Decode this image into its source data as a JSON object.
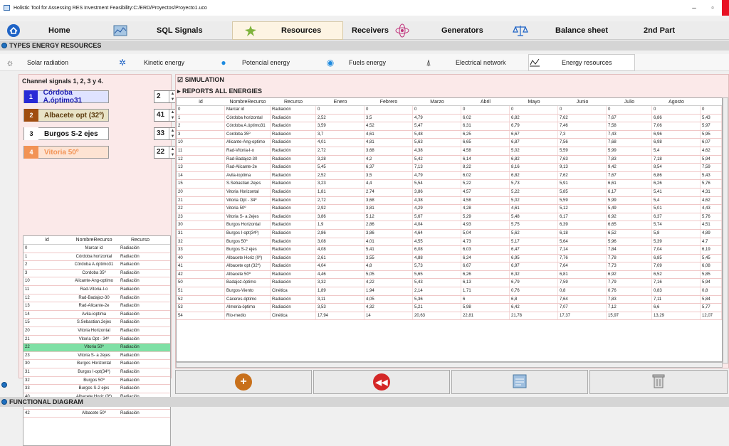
{
  "window": {
    "title": "Holistic Tool for Assessing RES Investment Feasibility:C:/ERD/Proyectos/Proyecto1.uco",
    "minimize": "–",
    "maximize": "▫",
    "close": "✕"
  },
  "nav": [
    {
      "label": "Home",
      "icon": "home-icon"
    },
    {
      "label": "SQL Signals",
      "icon": "signals-icon"
    },
    {
      "label": "Resources",
      "icon": "resources-icon"
    },
    {
      "label": "Receivers",
      "icon": "receivers-icon"
    },
    {
      "label": "Generators",
      "icon": "generators-icon"
    },
    {
      "label": "Balance sheet",
      "icon": "balance-icon"
    },
    {
      "label": "2nd Part",
      "icon": ""
    }
  ],
  "section_types": "TYPES ENERGY RESOURCES",
  "energy_tabs": [
    {
      "label": "Solar radiation",
      "icon": "sun-icon"
    },
    {
      "label": "Kinetic energy",
      "icon": "wind-icon"
    },
    {
      "label": "Potencial energy",
      "icon": "drop-icon"
    },
    {
      "label": "Fuels energy",
      "icon": "fuel-icon"
    },
    {
      "label": "Electrical network",
      "icon": "tower-icon"
    },
    {
      "label": "Energy resources",
      "icon": "chart-icon"
    }
  ],
  "left": {
    "title": "Channel signals 1,  2,  3 y 4.",
    "signals": [
      {
        "num": "1",
        "name": "Córdoba A.óptimo31",
        "spin": "2",
        "color": "#2a2ad6",
        "text": "#1d1db0",
        "bg": "#dfe3ff"
      },
      {
        "num": "2",
        "name": "Albacete opt (32º)",
        "spin": "41",
        "color": "#a04d10",
        "text": "#5b3a0c",
        "bg": "#e8e3c6"
      },
      {
        "num": "3",
        "name": "Burgos S-2 ejes",
        "spin": "33",
        "color": "#ffffff",
        "text": "#111",
        "bg": "#ffffff"
      },
      {
        "num": "4",
        "name": "Vitoria 50º",
        "spin": "22",
        "color": "#f29355",
        "text": "#f29355",
        "bg": "#fde3d3"
      }
    ],
    "table_headers": [
      "id",
      "NombreRecurso",
      "Recurso"
    ],
    "rows": [
      [
        "0",
        "Marcar id",
        "Radiación"
      ],
      [
        "1",
        "Córdoba horizontal",
        "Radiación"
      ],
      [
        "2",
        "Córdoba A.óptimo31",
        "Radiación"
      ],
      [
        "3",
        "Cordoba 35º",
        "Radiación"
      ],
      [
        "10",
        "Alicante-Ang-optimo",
        "Radiación"
      ],
      [
        "11",
        "Rad-Vitoria-I-o",
        "Radiación"
      ],
      [
        "12",
        "Rad-Badajoz-30",
        "Radiación"
      ],
      [
        "13",
        "Rad-Alicante-2e",
        "Radiación"
      ],
      [
        "14",
        "Avila-ioptima",
        "Radiación"
      ],
      [
        "15",
        "S.Sebastian.2ejes",
        "Radiación"
      ],
      [
        "20",
        "Vitoria Horizontal",
        "Radiación"
      ],
      [
        "21",
        "Vitoria Opt - 34º",
        "Radiación"
      ],
      [
        "22",
        "Vitoria 50º",
        "Radiación"
      ],
      [
        "23",
        "Vitoria S- a 2ejes",
        "Radiación"
      ],
      [
        "30",
        "Burgos Horizontal",
        "Radiación"
      ],
      [
        "31",
        "Burgos I-opt(34º)",
        "Radiación"
      ],
      [
        "32",
        "Burgos 50º",
        "Radiación"
      ],
      [
        "33",
        "Burgos S-2 ejes",
        "Radiación"
      ],
      [
        "40",
        "Albacete Horiz (0º)",
        "Radiación"
      ],
      [
        "41",
        "Albacete opt (32º)",
        "Radiación"
      ],
      [
        "42",
        "Albacete 50º",
        "Radiación"
      ]
    ],
    "selected_row": 12
  },
  "right": {
    "simulation": "SIMULATION",
    "reports": "REPORTS ALL ENERGIES",
    "headers": [
      "id",
      "NombreRecurso",
      "Recurso",
      "Enero",
      "Febrero",
      "Marzo",
      "Abril",
      "Mayo",
      "Junio",
      "Julio",
      "Agosto",
      ""
    ],
    "rows": [
      [
        "0",
        "Marcar id",
        "Radiación",
        "0",
        "0",
        "0",
        "0",
        "0",
        "0",
        "0",
        "0",
        "0"
      ],
      [
        "1",
        "Córdoba horizontal",
        "Radiación",
        "2,52",
        "3,5",
        "4,79",
        "6,02",
        "6,82",
        "7,62",
        "7,67",
        "6,86",
        "5,43"
      ],
      [
        "2",
        "Córdoba A.óptimo31",
        "Radiación",
        "3,59",
        "4,52",
        "5,47",
        "6,31",
        "6,79",
        "7,46",
        "7,58",
        "7,06",
        "5,97"
      ],
      [
        "3",
        "Cordoba 35º",
        "Radiación",
        "3,7",
        "4,61",
        "5,48",
        "6,25",
        "6,67",
        "7,3",
        "7,43",
        "6,96",
        "5,95"
      ],
      [
        "10",
        "Alicante-Ang-optimo",
        "Radiación",
        "4,01",
        "4,81",
        "5,63",
        "6,65",
        "6,87",
        "7,56",
        "7,68",
        "6,98",
        "6,07"
      ],
      [
        "11",
        "Rad-Vitoria-I-o",
        "Radiación",
        "2,72",
        "3,68",
        "4,38",
        "4,58",
        "5,02",
        "5,59",
        "5,99",
        "5,4",
        "4,62"
      ],
      [
        "12",
        "Rad-Badajoz-30",
        "Radiación",
        "3,28",
        "4,2",
        "5,42",
        "6,14",
        "6,82",
        "7,63",
        "7,83",
        "7,18",
        "5,94"
      ],
      [
        "13",
        "Rad-Alicante-2e",
        "Radiación",
        "5,45",
        "6,37",
        "7,13",
        "8,22",
        "8,16",
        "9,13",
        "9,42",
        "8,54",
        "7,59"
      ],
      [
        "14",
        "Avila-ioptima",
        "Radiación",
        "2,52",
        "3,5",
        "4,79",
        "6,02",
        "6,82",
        "7,62",
        "7,67",
        "6,86",
        "5,43"
      ],
      [
        "15",
        "S.Sebastian.2ejes",
        "Radiación",
        "3,23",
        "4,4",
        "5,54",
        "5,22",
        "5,73",
        "5,91",
        "6,61",
        "6,26",
        "5,76"
      ],
      [
        "20",
        "Vitoria Horizontal",
        "Radiación",
        "1,81",
        "2,74",
        "3,86",
        "4,57",
        "5,22",
        "5,85",
        "6,17",
        "5,41",
        "4,31"
      ],
      [
        "21",
        "Vitoria Opt - 34º",
        "Radiación",
        "2,72",
        "3,68",
        "4,38",
        "4,58",
        "5,02",
        "5,59",
        "5,99",
        "5,4",
        "4,62"
      ],
      [
        "22",
        "Vitoria 50º",
        "Radiación",
        "2,92",
        "3,81",
        "4,29",
        "4,28",
        "4,61",
        "5,12",
        "5,49",
        "5,01",
        "4,43"
      ],
      [
        "23",
        "Vitoria S- a 2ejes",
        "Radiación",
        "3,86",
        "5,12",
        "5,67",
        "5,29",
        "5,48",
        "6,17",
        "6,92",
        "6,37",
        "5,76"
      ],
      [
        "30",
        "Burgos Horizontal",
        "Radiación",
        "1,9",
        "2,86",
        "4,04",
        "4,93",
        "5,75",
        "6,39",
        "6,65",
        "5,74",
        "4,51"
      ],
      [
        "31",
        "Burgos I-opt(34º)",
        "Radiación",
        "2,86",
        "3,86",
        "4,64",
        "5,04",
        "5,62",
        "6,18",
        "6,52",
        "5,8",
        "4,89"
      ],
      [
        "32",
        "Burgos 50º",
        "Radiación",
        "3,08",
        "4,01",
        "4,55",
        "4,73",
        "5,17",
        "5,64",
        "5,96",
        "5,39",
        "4,7"
      ],
      [
        "33",
        "Burgos S-2 ejes",
        "Radiación",
        "4,08",
        "5,41",
        "6,08",
        "6,03",
        "6,47",
        "7,14",
        "7,84",
        "7,04",
        "6,19"
      ],
      [
        "40",
        "Albacete Horiz (0º)",
        "Radiación",
        "2,61",
        "3,55",
        "4,88",
        "6,24",
        "6,95",
        "7,76",
        "7,78",
        "6,85",
        "5,45"
      ],
      [
        "41",
        "Albacete opt (32º)",
        "Radiación",
        "4,04",
        "4,8",
        "5,73",
        "6,67",
        "6,97",
        "7,64",
        "7,73",
        "7,09",
        "6,08"
      ],
      [
        "42",
        "Albacete 50º",
        "Radiación",
        "4,46",
        "5,05",
        "5,65",
        "6,26",
        "6,32",
        "6,81",
        "6,92",
        "6,52",
        "5,85"
      ],
      [
        "50",
        "Badajoz-óptimo",
        "Radiación",
        "3,32",
        "4,22",
        "5,43",
        "6,13",
        "6,79",
        "7,59",
        "7,79",
        "7,16",
        "5,94"
      ],
      [
        "51",
        "Burgos-Viento",
        "Cinética",
        "1,89",
        "1,94",
        "2,14",
        "1,71",
        "0,76",
        "0,8",
        "0,76",
        "0,83",
        "0,8"
      ],
      [
        "52",
        "Cáceres-óptimo",
        "Radiación",
        "3,11",
        "4,05",
        "5,36",
        "6",
        "6,8",
        "7,64",
        "7,83",
        "7,11",
        "5,84"
      ],
      [
        "53",
        "Almeria-óptimo",
        "Radiación",
        "3,53",
        "4,32",
        "5,21",
        "5,98",
        "6,42",
        "7,07",
        "7,12",
        "6,6",
        "5,77"
      ],
      [
        "54",
        "Rio-medio",
        "Cinética",
        "17,94",
        "14",
        "20,63",
        "22,81",
        "21,78",
        "17,37",
        "15,97",
        "13,29",
        "12,07"
      ]
    ]
  },
  "status": "FUNCTIONAL DIAGRAM"
}
